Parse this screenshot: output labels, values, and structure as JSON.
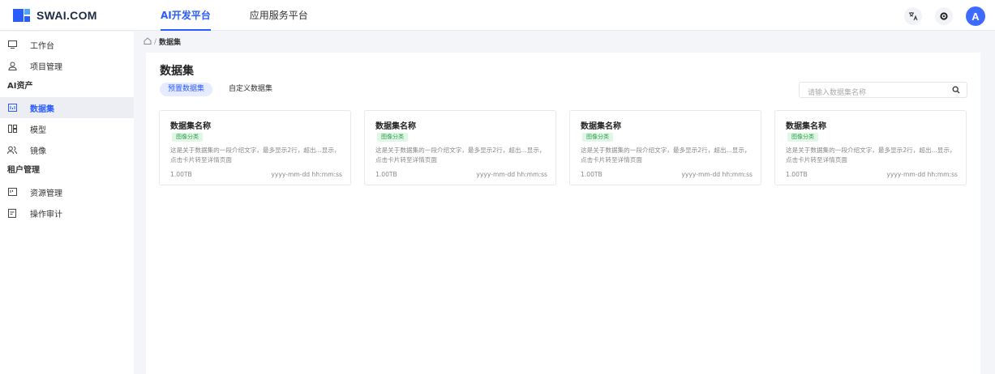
{
  "header": {
    "logo_text": "SWAI.COM",
    "tabs": [
      {
        "label": "AI开发平台",
        "active": true
      },
      {
        "label": "应用服务平台",
        "active": false
      }
    ],
    "avatar_initial": "A",
    "accent_color": "#2b5cff"
  },
  "sidebar": {
    "items_top": [
      {
        "label": "工作台",
        "icon": "monitor-icon"
      },
      {
        "label": "项目管理",
        "icon": "user-icon"
      }
    ],
    "group_ai": "AI资产",
    "items_ai": [
      {
        "label": "数据集",
        "icon": "dataset-icon",
        "active": true
      },
      {
        "label": "模型",
        "icon": "model-icon"
      },
      {
        "label": "镜像",
        "icon": "image-mirror-icon"
      }
    ],
    "group_tenant": "租户管理",
    "items_tenant": [
      {
        "label": "资源管理",
        "icon": "resource-icon"
      },
      {
        "label": "操作审计",
        "icon": "audit-icon"
      }
    ]
  },
  "breadcrumb": {
    "separator": "/",
    "current": "数据集"
  },
  "main": {
    "title": "数据集",
    "sub_tabs": [
      {
        "label": "预置数据集",
        "active": true
      },
      {
        "label": "自定义数据集",
        "active": false
      }
    ],
    "search_placeholder": "请输入数据集名称"
  },
  "cards": [
    {
      "title": "数据集名称",
      "badge": "图像分类",
      "desc": "这是关于数据集的一段介绍文字，最多显示2行，超出...显示，点击卡片转至详情页面",
      "size": "1.00TB",
      "time": "yyyy-mm-dd hh:mm:ss"
    },
    {
      "title": "数据集名称",
      "badge": "图像分类",
      "desc": "这是关于数据集的一段介绍文字，最多显示2行，超出...显示，点击卡片转至详情页面",
      "size": "1.00TB",
      "time": "yyyy-mm-dd hh:mm:ss"
    },
    {
      "title": "数据集名称",
      "badge": "图像分类",
      "desc": "这是关于数据集的一段介绍文字，最多显示2行，超出...显示，点击卡片转至详情页面",
      "size": "1.00TB",
      "time": "yyyy-mm-dd hh:mm:ss"
    },
    {
      "title": "数据集名称",
      "badge": "图像分类",
      "desc": "这是关于数据集的一段介绍文字，最多显示2行，超出...显示，点击卡片转至详情页面",
      "size": "1.00TB",
      "time": "yyyy-mm-dd hh:mm:ss"
    }
  ]
}
